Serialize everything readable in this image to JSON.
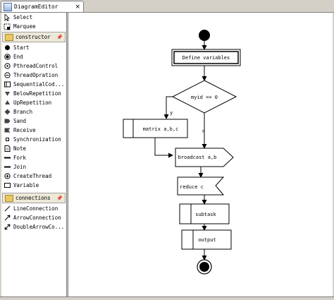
{
  "editor": {
    "tab_title": "DiagramEditor",
    "close_glyph": "×"
  },
  "palette": {
    "tools": [
      {
        "label": "Select",
        "icon": "arrow-cursor-icon"
      },
      {
        "label": "Marquee",
        "icon": "marquee-icon"
      }
    ],
    "drawers": [
      {
        "label": "constructor",
        "items": [
          {
            "label": "Start",
            "icon": "start-node-icon"
          },
          {
            "label": "End",
            "icon": "end-node-icon"
          },
          {
            "label": "PthreadControl",
            "icon": "pthread-control-icon"
          },
          {
            "label": "ThreadOpration",
            "icon": "thread-operation-icon"
          },
          {
            "label": "SequentialCod...",
            "icon": "sequential-code-icon"
          },
          {
            "label": "BelowRepetition",
            "icon": "below-repetition-icon"
          },
          {
            "label": "UpRepetition",
            "icon": "up-repetition-icon"
          },
          {
            "label": "Branch",
            "icon": "branch-icon"
          },
          {
            "label": "Sand",
            "icon": "send-icon"
          },
          {
            "label": "Receive",
            "icon": "receive-icon"
          },
          {
            "label": "Synchronization",
            "icon": "synchronization-icon"
          },
          {
            "label": "Note",
            "icon": "note-icon"
          },
          {
            "label": "Fork",
            "icon": "fork-icon"
          },
          {
            "label": "Join",
            "icon": "join-icon"
          },
          {
            "label": "CreateThread",
            "icon": "create-thread-icon"
          },
          {
            "label": "Variable",
            "icon": "variable-icon"
          }
        ]
      },
      {
        "label": "connections",
        "items": [
          {
            "label": "LineConnection",
            "icon": "line-connection-icon"
          },
          {
            "label": "ArrowConnection",
            "icon": "arrow-connection-icon"
          },
          {
            "label": "DoubleArrowCo...",
            "icon": "double-arrow-connection-icon"
          }
        ]
      }
    ]
  },
  "diagram": {
    "define_label": "Define variables",
    "decision_label": "myid == 0",
    "yes_label": "y",
    "no_label": "n",
    "matrix_label": "matrix  a,b,c",
    "broadcast_label": "broadcast  a,b",
    "reduce_label": "reduce c",
    "subtask_label": "subtask",
    "output_label": "output"
  },
  "colors": {
    "canvas": "#ffffff",
    "chrome": "#d4d0c8",
    "drawer": "#ece9d8",
    "folder": "#e8c860"
  }
}
